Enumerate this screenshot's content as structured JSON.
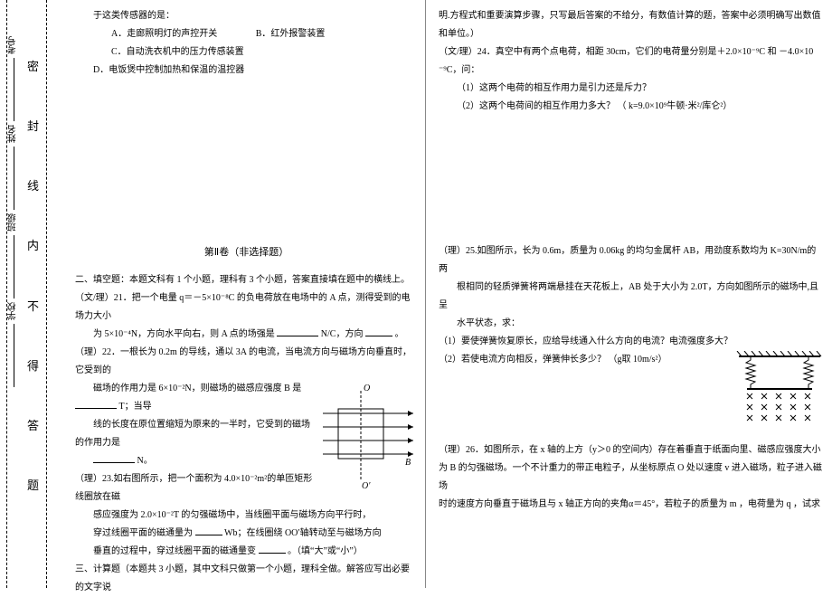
{
  "binding": {
    "labels": [
      "考号",
      "姓名",
      "班级",
      "学校"
    ],
    "seal_chars": [
      "密",
      "封",
      "线",
      "内",
      "不",
      "得",
      "答",
      "题"
    ]
  },
  "left": {
    "stem_cont": "于这类传感器的是：",
    "opt_a": "A．走廊照明灯的声控开关",
    "opt_b": "B．红外报警装置",
    "opt_c": "C．自动洗衣机中的压力传感装置",
    "opt_d": "D．电饭煲中控制加热和保温的温控器",
    "section_title": "第Ⅱ卷（非选择题）",
    "fill_header": "二、填空题：本题文科有 1 个小题，理科有 3 个小题，答案直接填在题中的横线上。",
    "q21": "（文/理）21．把一个电量 q＝－5×10⁻⁸C 的负电荷放在电场中的 A 点，测得受到的电场力大小",
    "q21b": "为 5×10⁻⁴N，方向水平向右，则 A 点的场强是",
    "q21c": "N/C，方向",
    "q21d": "。",
    "q22": "（理）22．一根长为 0.2m 的导线，通以 3A 的电流，当电流方向与磁场方向垂直时，它受到的",
    "q22b": "磁场的作用力是 6×10⁻²N，则磁场的磁感应强度 B 是",
    "q22c": "T；当导",
    "q22d": "线的长度在原位置缩短为原来的一半时，它受到的磁场的作用力是",
    "q22e": "N。",
    "q23": "（理）23.如右图所示，把一个面积为 4.0×10⁻²m²的单匝矩形线圈放在磁",
    "q23b": "感应强度为 2.0×10⁻²T 的匀强磁场中，当线圈平面与磁场方向平行时，",
    "q23c": "穿过线圈平面的磁通量为",
    "q23d": "Wb；在线圈绕 OO′轴转动至与磁场方向",
    "q23e": "垂直的过程中，穿过线圈平面的磁通量变",
    "q23f": "。（填“大”或“小”）",
    "calc_header": "三、计算题（本题共 3 小题，其中文科只做第一个小题，理科全做。解答应写出必要的文字说",
    "label_O": "O",
    "label_B": "B",
    "label_Op": "O′"
  },
  "right": {
    "cont": "明.方程式和重要演算步骤，只写最后答案的不给分，有数值计算的题，答案中必须明确写出数值和单位。）",
    "q24": "（文/理）24．真空中有两个点电荷，相距 30cm，它们的电荷量分别是＋2.0×10⁻⁹C 和 －4.0×10",
    "q24b": "⁻⁹C，问：",
    "q24_1": "（1）这两个电荷的相互作用力是引力还是斥力？",
    "q24_2": "（2）这两个电荷间的相互作用力多大？ （ k=9.0×10⁹牛顿·米²/库仑²）",
    "q25": "（理）25.如图所示，长为 0.6m，质量为 0.06kg 的均匀金属杆 AB，用劲度系数均为 K=30N/m的两",
    "q25b": "根相同的轻质弹簧将两端悬挂在天花板上，AB 处于大小为 2.0T，方向如图所示的磁场中,且呈",
    "q25c": "水平状态，求：",
    "q25_1": "（1）要使弹簧恢复原长，应给导线通入什么方向的电流？电流强度多大？",
    "q25_2": "（2）若使电流方向相反，弹簧伸长多少？ （g取 10m/s²）",
    "q26": "（理）26．如图所示，在 x 轴的上方（y＞0 的空间内）存在着垂直于纸面向里、磁感应强度大小",
    "q26b": "为 B 的匀强磁场。一个不计重力的带正电粒子，从坐标原点 O 处以速度 v 进入磁场，粒子进入磁场",
    "q26c": "时的速度方向垂直于磁场且与 x 轴正方向的夹角α＝45°，若粒子的质量为 m ，电荷量为 q ，试求"
  }
}
